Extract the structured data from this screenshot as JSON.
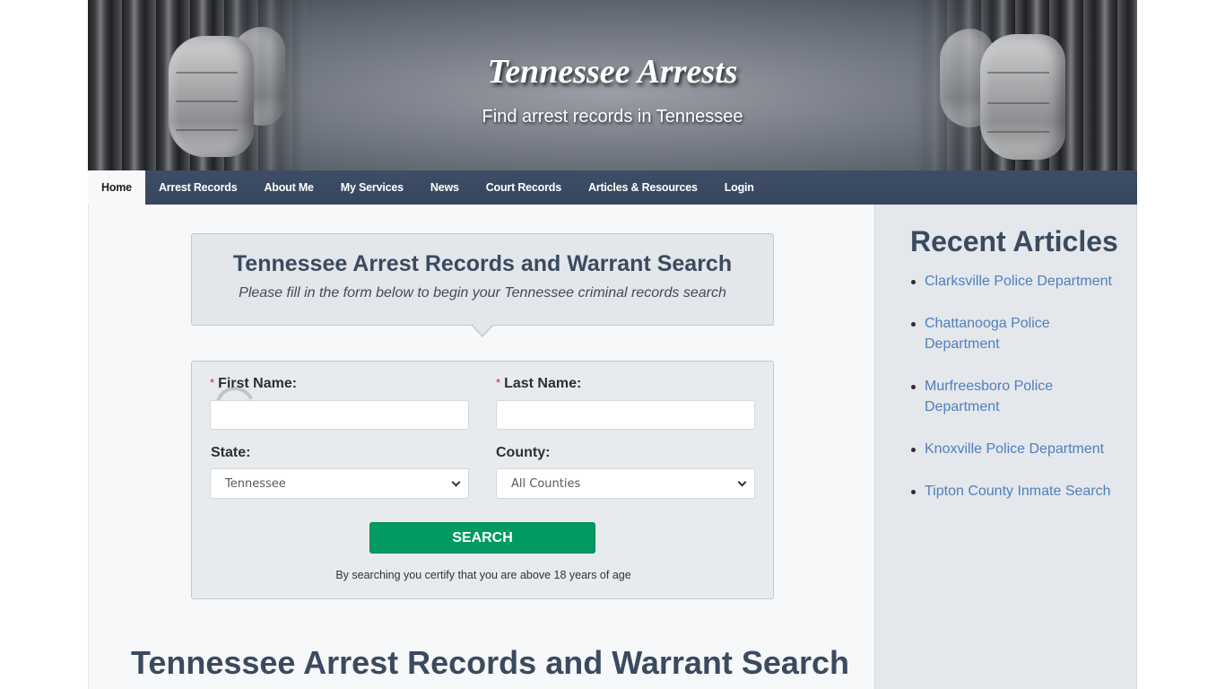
{
  "header": {
    "site_title": "Tennessee Arrests",
    "tagline": "Find arrest records in Tennessee"
  },
  "nav": {
    "items": [
      {
        "label": "Home",
        "active": true
      },
      {
        "label": "Arrest Records"
      },
      {
        "label": "About Me"
      },
      {
        "label": "My Services"
      },
      {
        "label": "News"
      },
      {
        "label": "Court Records"
      },
      {
        "label": "Articles & Resources"
      },
      {
        "label": "Login"
      }
    ]
  },
  "search_intro": {
    "title": "Tennessee Arrest Records and Warrant Search",
    "subtitle": "Please fill in the form below to begin your Tennessee criminal records search"
  },
  "search_form": {
    "required_marker": "*",
    "first_name": {
      "label": "First Name:",
      "value": "",
      "required": true
    },
    "last_name": {
      "label": "Last Name:",
      "value": "",
      "required": true
    },
    "state": {
      "label": "State:",
      "selected": "Tennessee"
    },
    "county": {
      "label": "County:",
      "selected": "All Counties"
    },
    "search_button": "SEARCH",
    "certify_text": "By searching you certify that you are above 18 years of age"
  },
  "content": {
    "heading": "Tennessee Arrest Records and Warrant Search"
  },
  "sidebar": {
    "title": "Recent Articles",
    "articles": [
      "Clarksville Police Department",
      "Chattanooga Police Department",
      "Murfreesboro Police Department",
      "Knoxville Police Department",
      "Tipton County Inmate Search"
    ]
  },
  "colors": {
    "nav_bg": "#2d3e58",
    "heading_text": "#3a4a5f",
    "search_button": "#019a63",
    "link": "#4f80bb",
    "required": "#d2232a"
  }
}
